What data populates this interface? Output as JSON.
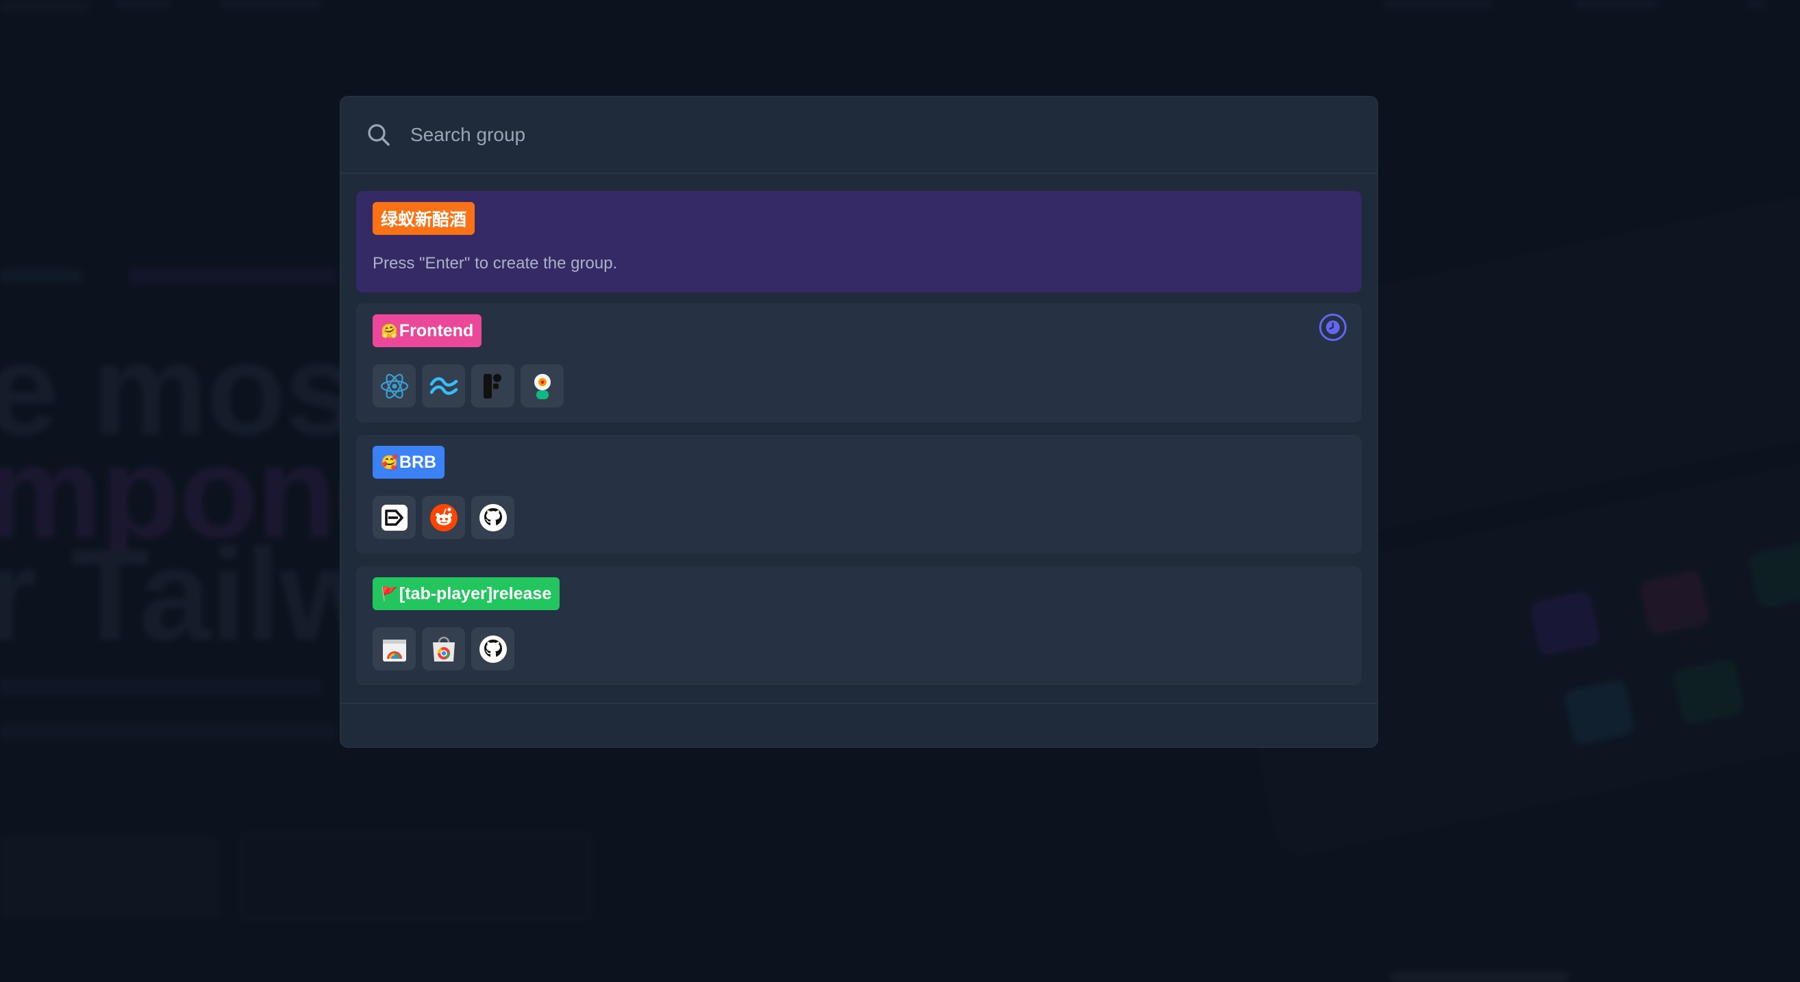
{
  "search": {
    "placeholder": "Search group",
    "value": ""
  },
  "new_group": {
    "tag_label": "绿蚁新醅酒",
    "tag_color": "#f97316",
    "hint": "Press \"Enter\" to create the group."
  },
  "groups": [
    {
      "emoji": "🤗",
      "label": "Frontend",
      "tag_color": "#ec4899",
      "has_clock": true,
      "icons": [
        "react-icon",
        "tailwind-icon",
        "framer-icon",
        "mascot-icon"
      ]
    },
    {
      "emoji": "🥰",
      "label": "BRB",
      "tag_color": "#3b82f6",
      "has_clock": false,
      "icons": [
        "dev-logo-icon",
        "reddit-icon",
        "github-icon"
      ]
    },
    {
      "emoji": "🚩",
      "label": "[tab-player]release",
      "tag_color": "#22c55e",
      "has_clock": false,
      "icons": [
        "chrome-web-store-icon",
        "chrome-web-store-icon",
        "github-icon"
      ]
    }
  ],
  "colors": {
    "modal_bg": "#1f2a3b",
    "highlight_bg": "#362a66",
    "clock_accent": "#6366f1"
  }
}
